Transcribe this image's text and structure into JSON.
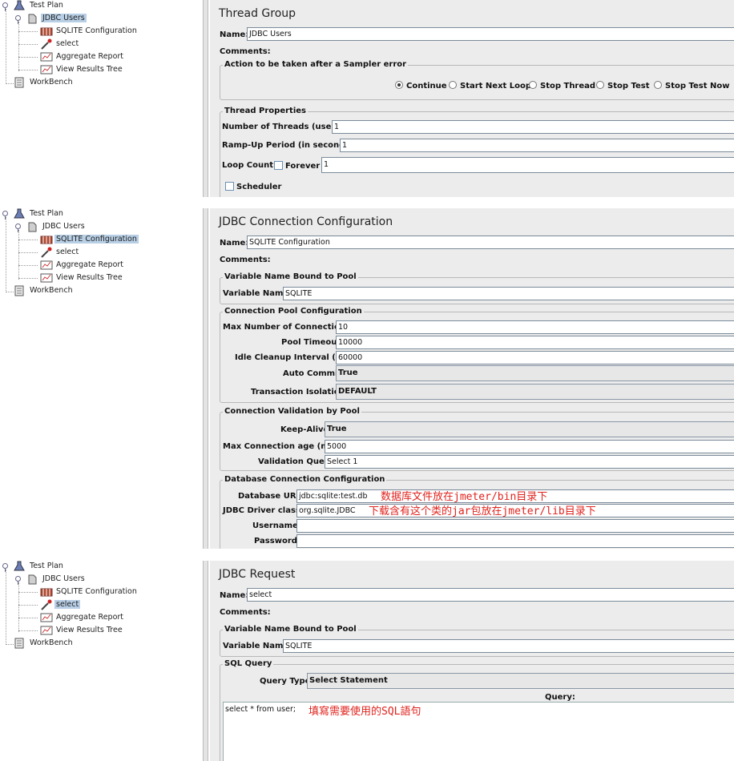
{
  "tree": {
    "test_plan": "Test Plan",
    "jdbc_users": "JDBC Users",
    "sqlite_config": "SQLITE Configuration",
    "select": "select",
    "aggregate_report": "Aggregate Report",
    "view_results_tree": "View Results Tree",
    "workbench": "WorkBench"
  },
  "panels": [
    {
      "selected": "jdbc_users",
      "title": "Thread Group",
      "name_label": "Name:",
      "name_value": "JDBC Users",
      "comments_label": "Comments:",
      "sampler_error": {
        "legend": "Action to be taken after a Sampler error",
        "options": [
          "Continue",
          "Start Next Loop",
          "Stop Thread",
          "Stop Test",
          "Stop Test Now"
        ],
        "selected": "Continue"
      },
      "thread_props": {
        "legend": "Thread Properties",
        "threads_label": "Number of Threads (users):",
        "threads_value": "1",
        "rampup_label": "Ramp-Up Period (in seconds):",
        "rampup_value": "1",
        "loop_label": "Loop Count:",
        "forever_label": "Forever",
        "loop_value": "1",
        "scheduler_label": "Scheduler"
      }
    },
    {
      "selected": "sqlite_config",
      "title": "JDBC Connection Configuration",
      "name_label": "Name:",
      "name_value": "SQLITE Configuration",
      "comments_label": "Comments:",
      "var_section": {
        "legend": "Variable Name Bound to Pool",
        "label": "Variable Name:",
        "value": "SQLITE"
      },
      "pool_section": {
        "legend": "Connection Pool Configuration",
        "max_conn_label": "Max Number of Connections:",
        "max_conn_value": "10",
        "timeout_label": "Pool Timeout:",
        "timeout_value": "10000",
        "idle_label": "Idle Cleanup Interval (ms):",
        "idle_value": "60000",
        "autocommit_label": "Auto Commit:",
        "autocommit_value": "True",
        "isolation_label": "Transaction Isolation:",
        "isolation_value": "DEFAULT"
      },
      "validation_section": {
        "legend": "Connection Validation by Pool",
        "keepalive_label": "Keep-Alive:",
        "keepalive_value": "True",
        "max_age_label": "Max Connection age (ms):",
        "max_age_value": "5000",
        "query_label": "Validation Query:",
        "query_value": "Select 1"
      },
      "db_section": {
        "legend": "Database Connection Configuration",
        "url_label": "Database URL:",
        "url_value": "jdbc:sqlite:test.db",
        "url_note": "数据库文件放在jmeter/bin目录下",
        "driver_label": "JDBC Driver class:",
        "driver_value": "org.sqlite.JDBC",
        "driver_note": "下载含有这个类的jar包放在jmeter/lib目录下",
        "username_label": "Username:",
        "password_label": "Password:"
      }
    },
    {
      "selected": "select",
      "title": "JDBC Request",
      "name_label": "Name:",
      "name_value": "select",
      "comments_label": "Comments:",
      "var_section": {
        "legend": "Variable Name Bound to Pool",
        "label": "Variable Name:",
        "value": "SQLITE"
      },
      "sql_section": {
        "legend": "SQL Query",
        "type_label": "Query Type:",
        "type_value": "Select Statement",
        "query_header": "Query:",
        "query_text": "select * from user;",
        "query_note": "填寫需要使用的SQL語句"
      }
    }
  ],
  "colors": {
    "selection": "#b8cfe5",
    "panel_bg": "#ececec",
    "annotation": "#e0231d"
  }
}
